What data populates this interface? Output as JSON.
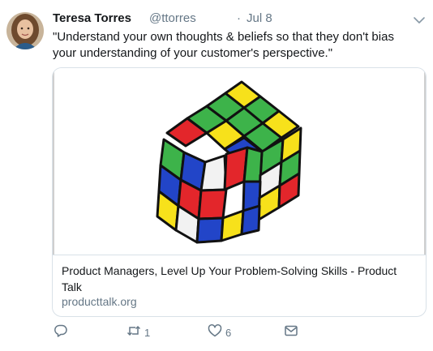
{
  "tweet": {
    "author_name": "Teresa Torres",
    "handle": "@ttorres",
    "separator": "·",
    "date": "Jul 8",
    "text": "\"Understand your own thoughts & beliefs so that they don't bias your understanding of your customer's perspective.\""
  },
  "card": {
    "title": "Product Managers, Level Up Your Problem-Solving Skills - Product Talk",
    "domain": "producttalk.org"
  },
  "actions": {
    "reply_count": "",
    "retweet_count": "1",
    "like_count": "6"
  },
  "colors": {
    "secondary_text": "#657786",
    "border": "#d9e1e8",
    "cube_green": "#3db34a",
    "cube_yellow": "#f7e11b",
    "cube_red": "#e3262b",
    "cube_blue": "#2245c8",
    "cube_white": "#f2f2f2"
  },
  "icons": {
    "avatar": "profile-photo",
    "chevron": "chevron-down-icon",
    "reply": "reply-icon",
    "retweet": "retweet-icon",
    "like": "heart-icon",
    "dm": "envelope-icon"
  }
}
